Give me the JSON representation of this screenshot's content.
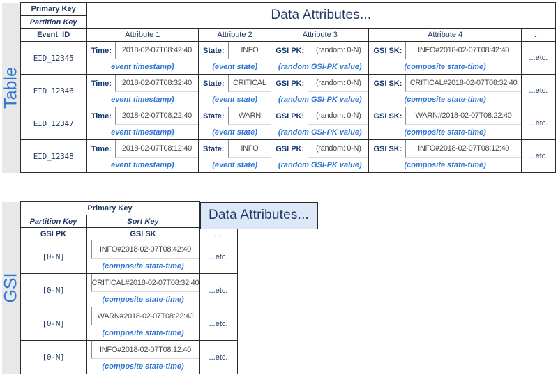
{
  "colors": {
    "header_blue": "#dce8f5",
    "accent_blue": "#2e75d4",
    "grey_band": "#f1f1f1",
    "rail_grey": "#e8e8e8",
    "border": "#2b2b2b"
  },
  "table": {
    "rail_label": "Table",
    "primary_key_label": "Primary Key",
    "partition_key_label": "Partition Key",
    "data_attributes_label": "Data Attributes...",
    "columns": {
      "pk": "Event_ID",
      "attr1": "Attribute 1",
      "attr2": "Attribute 2",
      "attr3": "Attribute 3",
      "attr4": "Attribute 4",
      "more": "..."
    },
    "captions": {
      "time": "event timestamp)",
      "state": "(event state)",
      "gsipk": "(random GSI-PK value)",
      "gsisk": "(composite state-time)"
    },
    "labels": {
      "time": "Time:",
      "state": "State:",
      "gsipk": "GSI PK:",
      "gsisk": "GSI SK:"
    },
    "etc": "...etc.",
    "rows": [
      {
        "event_id": "EID_12345",
        "time": "2018-02-07T08:42:40",
        "state": "INFO",
        "gsi_pk": "(random: 0-N)",
        "gsi_sk": "INFO#2018-02-07T08:42:40"
      },
      {
        "event_id": "EID_12346",
        "time": "2018-02-07T08:32:40",
        "state": "CRITICAL",
        "gsi_pk": "(random: 0-N)",
        "gsi_sk": "CRITICAL#2018-02-07T08:32:40"
      },
      {
        "event_id": "EID_12347",
        "time": "2018-02-07T08:22:40",
        "state": "WARN",
        "gsi_pk": "(random: 0-N)",
        "gsi_sk": "WARN#2018-02-07T08:22:40"
      },
      {
        "event_id": "EID_12348",
        "time": "2018-02-07T08:12:40",
        "state": "INFO",
        "gsi_pk": "(random: 0-N)",
        "gsi_sk": "INFO#2018-02-07T08:12:40"
      }
    ]
  },
  "gsi": {
    "rail_label": "GSI",
    "primary_key_label": "Primary Key",
    "partition_key_label": "Partition Key",
    "sort_key_label": "Sort Key",
    "data_attributes_label": "Data Attributes...",
    "columns": {
      "pk": "GSI PK",
      "sk": "GSI SK",
      "more": "..."
    },
    "caption": "(composite state-time)",
    "etc": "...etc.",
    "rows": [
      {
        "gsi_pk": "[0-N]",
        "gsi_sk": "INFO#2018-02-07T08:42:40"
      },
      {
        "gsi_pk": "[0-N]",
        "gsi_sk": "CRITICAL#2018-02-07T08:32:40"
      },
      {
        "gsi_pk": "[0-N]",
        "gsi_sk": "WARN#2018-02-07T08:22:40"
      },
      {
        "gsi_pk": "[0-N]",
        "gsi_sk": "INFO#2018-02-07T08:12:40"
      }
    ]
  }
}
